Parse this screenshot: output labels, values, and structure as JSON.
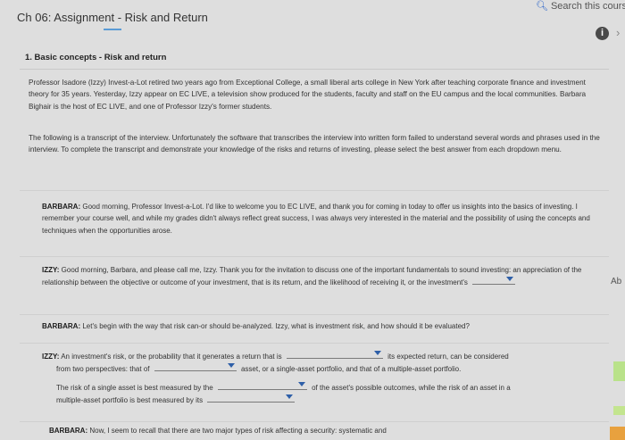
{
  "header": {
    "title": "Ch 06: Assignment - Risk and Return",
    "search_placeholder": "Search this cours"
  },
  "section": {
    "title": "1. Basic concepts - Risk and return",
    "info_label": "i"
  },
  "intro": {
    "p1": "Professor Isadore (Izzy) Invest-a-Lot retired two years ago from Exceptional College, a small liberal arts college in New York after teaching corporate finance and investment theory for 35 years. Yesterday, Izzy appear on EC LIVE, a television show produced for the students, faculty and staff on the EU campus and the local communities. Barbara Bighair is the host of EC LIVE, and one of Professor Izzy's former students.",
    "p2": "The following is a transcript of the interview. Unfortunately the software that transcribes the interview into written form failed to understand several words and phrases used in the interview. To complete the transcript and demonstrate your knowledge of the risks and returns of investing, please select the best answer from each dropdown menu."
  },
  "dialogue": {
    "b1_speaker": "BARBARA:",
    "b1_text": "Good morning, Professor Invest-a-Lot. I'd like to welcome you to EC LIVE, and thank you for coming in today to offer us insights into the basics of investing. I remember your course well, and while my grades didn't always reflect great success, I was always very interested in the material and the possibility of using the concepts and techniques when the opportunities arose.",
    "i1_speaker": "IZZY:",
    "i1_text": "Good morning, Barbara, and please call me, Izzy. Thank you for the invitation to discuss one of the important fundamentals to sound investing: an appreciation of the relationship between the objective or outcome of your investment, that is its return, and the likelihood of receiving it, or the investment's",
    "b2_speaker": "BARBARA:",
    "b2_text": "Let's begin with the way that risk can-or should be-analyzed. Izzy, what is investment risk, and how should it be evaluated?",
    "i2_speaker": "IZZY:",
    "i2_a": "An investment's risk, or the probability that it generates a return that is",
    "i2_b": "its expected return, can be considered",
    "i2_c": "from two perspectives: that of",
    "i2_d": "asset, or a single-asset portfolio, and that of a multiple-asset portfolio.",
    "i2_e": "The risk of a single asset is best measured by the",
    "i2_f": "of the asset's possible outcomes, while the risk of an asset in a",
    "i2_g": "multiple-asset portfolio is best measured by its",
    "b3_speaker": "BARBARA:",
    "b3_text": "Now, I seem to recall that there are two major types of risk affecting a security: systematic and"
  },
  "side": {
    "ab_label": "Ab"
  }
}
